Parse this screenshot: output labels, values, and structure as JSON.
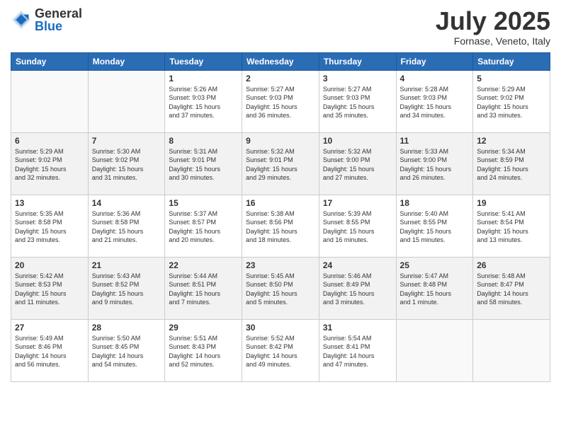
{
  "header": {
    "logo": {
      "general": "General",
      "blue": "Blue"
    },
    "title": "July 2025",
    "location": "Fornase, Veneto, Italy"
  },
  "days_of_week": [
    "Sunday",
    "Monday",
    "Tuesday",
    "Wednesday",
    "Thursday",
    "Friday",
    "Saturday"
  ],
  "weeks": [
    {
      "shade": false,
      "days": [
        {
          "num": "",
          "info": ""
        },
        {
          "num": "",
          "info": ""
        },
        {
          "num": "1",
          "info": "Sunrise: 5:26 AM\nSunset: 9:03 PM\nDaylight: 15 hours\nand 37 minutes."
        },
        {
          "num": "2",
          "info": "Sunrise: 5:27 AM\nSunset: 9:03 PM\nDaylight: 15 hours\nand 36 minutes."
        },
        {
          "num": "3",
          "info": "Sunrise: 5:27 AM\nSunset: 9:03 PM\nDaylight: 15 hours\nand 35 minutes."
        },
        {
          "num": "4",
          "info": "Sunrise: 5:28 AM\nSunset: 9:03 PM\nDaylight: 15 hours\nand 34 minutes."
        },
        {
          "num": "5",
          "info": "Sunrise: 5:29 AM\nSunset: 9:02 PM\nDaylight: 15 hours\nand 33 minutes."
        }
      ]
    },
    {
      "shade": true,
      "days": [
        {
          "num": "6",
          "info": "Sunrise: 5:29 AM\nSunset: 9:02 PM\nDaylight: 15 hours\nand 32 minutes."
        },
        {
          "num": "7",
          "info": "Sunrise: 5:30 AM\nSunset: 9:02 PM\nDaylight: 15 hours\nand 31 minutes."
        },
        {
          "num": "8",
          "info": "Sunrise: 5:31 AM\nSunset: 9:01 PM\nDaylight: 15 hours\nand 30 minutes."
        },
        {
          "num": "9",
          "info": "Sunrise: 5:32 AM\nSunset: 9:01 PM\nDaylight: 15 hours\nand 29 minutes."
        },
        {
          "num": "10",
          "info": "Sunrise: 5:32 AM\nSunset: 9:00 PM\nDaylight: 15 hours\nand 27 minutes."
        },
        {
          "num": "11",
          "info": "Sunrise: 5:33 AM\nSunset: 9:00 PM\nDaylight: 15 hours\nand 26 minutes."
        },
        {
          "num": "12",
          "info": "Sunrise: 5:34 AM\nSunset: 8:59 PM\nDaylight: 15 hours\nand 24 minutes."
        }
      ]
    },
    {
      "shade": false,
      "days": [
        {
          "num": "13",
          "info": "Sunrise: 5:35 AM\nSunset: 8:58 PM\nDaylight: 15 hours\nand 23 minutes."
        },
        {
          "num": "14",
          "info": "Sunrise: 5:36 AM\nSunset: 8:58 PM\nDaylight: 15 hours\nand 21 minutes."
        },
        {
          "num": "15",
          "info": "Sunrise: 5:37 AM\nSunset: 8:57 PM\nDaylight: 15 hours\nand 20 minutes."
        },
        {
          "num": "16",
          "info": "Sunrise: 5:38 AM\nSunset: 8:56 PM\nDaylight: 15 hours\nand 18 minutes."
        },
        {
          "num": "17",
          "info": "Sunrise: 5:39 AM\nSunset: 8:55 PM\nDaylight: 15 hours\nand 16 minutes."
        },
        {
          "num": "18",
          "info": "Sunrise: 5:40 AM\nSunset: 8:55 PM\nDaylight: 15 hours\nand 15 minutes."
        },
        {
          "num": "19",
          "info": "Sunrise: 5:41 AM\nSunset: 8:54 PM\nDaylight: 15 hours\nand 13 minutes."
        }
      ]
    },
    {
      "shade": true,
      "days": [
        {
          "num": "20",
          "info": "Sunrise: 5:42 AM\nSunset: 8:53 PM\nDaylight: 15 hours\nand 11 minutes."
        },
        {
          "num": "21",
          "info": "Sunrise: 5:43 AM\nSunset: 8:52 PM\nDaylight: 15 hours\nand 9 minutes."
        },
        {
          "num": "22",
          "info": "Sunrise: 5:44 AM\nSunset: 8:51 PM\nDaylight: 15 hours\nand 7 minutes."
        },
        {
          "num": "23",
          "info": "Sunrise: 5:45 AM\nSunset: 8:50 PM\nDaylight: 15 hours\nand 5 minutes."
        },
        {
          "num": "24",
          "info": "Sunrise: 5:46 AM\nSunset: 8:49 PM\nDaylight: 15 hours\nand 3 minutes."
        },
        {
          "num": "25",
          "info": "Sunrise: 5:47 AM\nSunset: 8:48 PM\nDaylight: 15 hours\nand 1 minute."
        },
        {
          "num": "26",
          "info": "Sunrise: 5:48 AM\nSunset: 8:47 PM\nDaylight: 14 hours\nand 58 minutes."
        }
      ]
    },
    {
      "shade": false,
      "days": [
        {
          "num": "27",
          "info": "Sunrise: 5:49 AM\nSunset: 8:46 PM\nDaylight: 14 hours\nand 56 minutes."
        },
        {
          "num": "28",
          "info": "Sunrise: 5:50 AM\nSunset: 8:45 PM\nDaylight: 14 hours\nand 54 minutes."
        },
        {
          "num": "29",
          "info": "Sunrise: 5:51 AM\nSunset: 8:43 PM\nDaylight: 14 hours\nand 52 minutes."
        },
        {
          "num": "30",
          "info": "Sunrise: 5:52 AM\nSunset: 8:42 PM\nDaylight: 14 hours\nand 49 minutes."
        },
        {
          "num": "31",
          "info": "Sunrise: 5:54 AM\nSunset: 8:41 PM\nDaylight: 14 hours\nand 47 minutes."
        },
        {
          "num": "",
          "info": ""
        },
        {
          "num": "",
          "info": ""
        }
      ]
    }
  ]
}
